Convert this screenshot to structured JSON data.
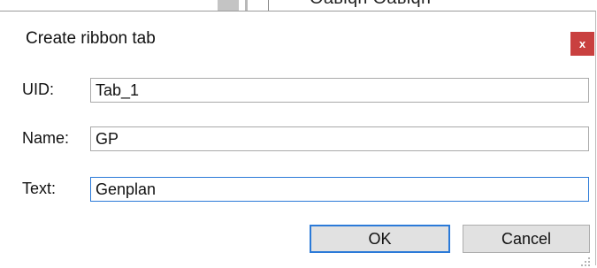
{
  "background": {
    "partial_text": "Оавiqн Оавiqн"
  },
  "dialog": {
    "title": "Create ribbon tab",
    "close_glyph": "x",
    "fields": [
      {
        "label": "UID:",
        "value": "Tab_1",
        "focused": false
      },
      {
        "label": "Name:",
        "value": "GP",
        "focused": false
      },
      {
        "label": "Text:",
        "value": "Genplan",
        "focused": true
      }
    ],
    "buttons": {
      "ok_label": "OK",
      "cancel_label": "Cancel"
    }
  }
}
